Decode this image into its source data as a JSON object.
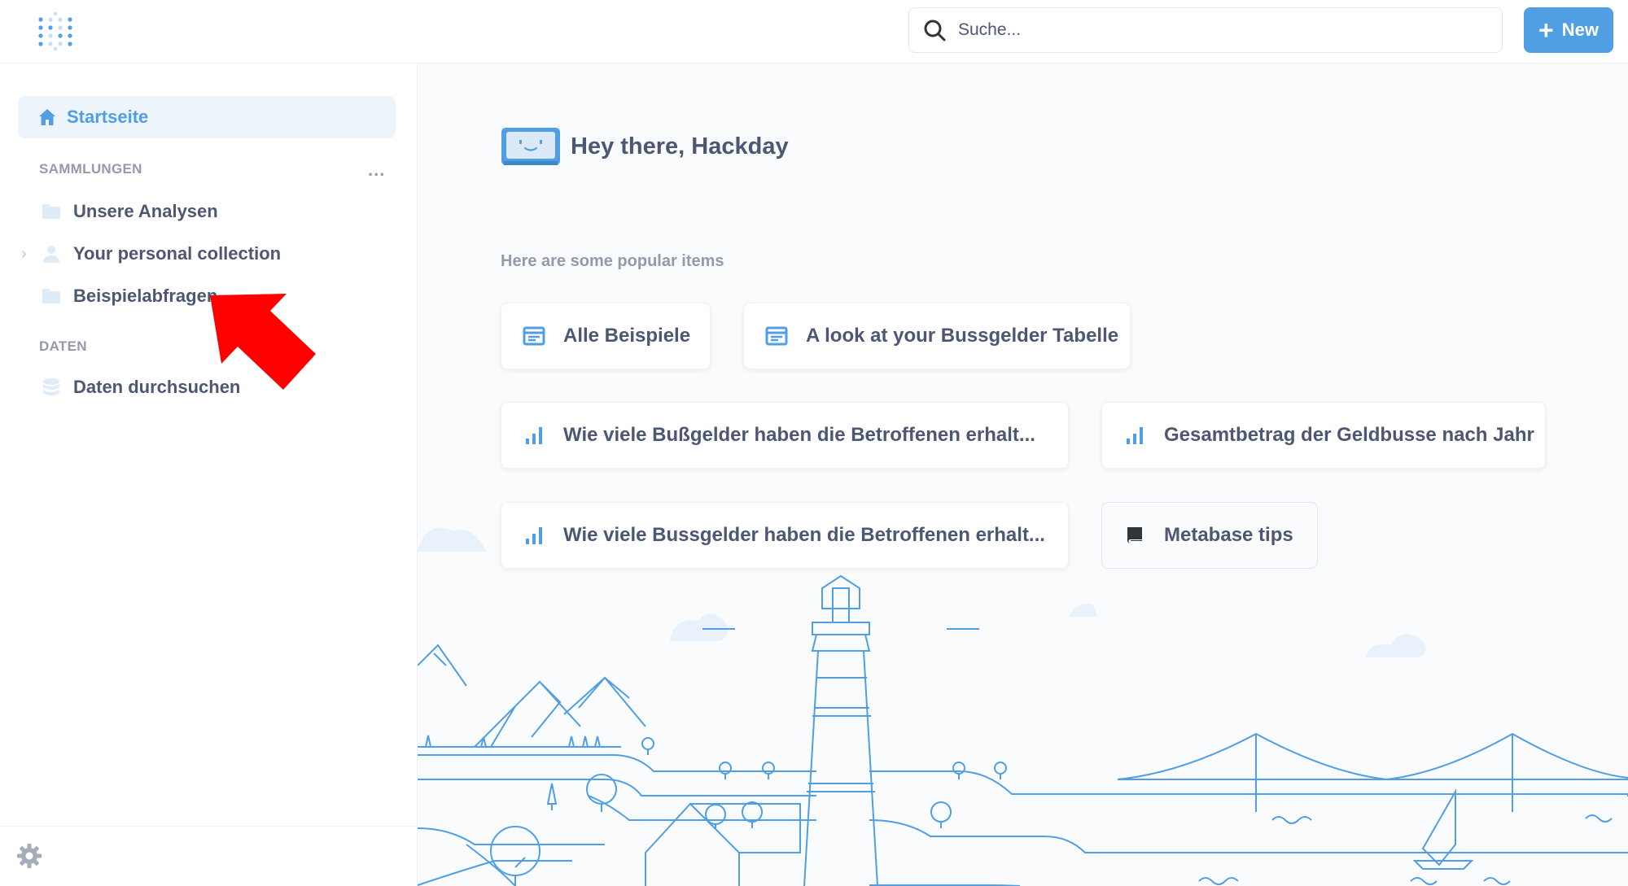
{
  "header": {
    "search_placeholder": "Suche...",
    "new_label": "New",
    "accent_color": "#509ee3"
  },
  "sidebar": {
    "home_label": "Startseite",
    "collections_title": "SAMMLUNGEN",
    "collections_more": "...",
    "collections": [
      {
        "label": "Unsere Analysen",
        "icon": "folder-icon"
      },
      {
        "label": "Your personal collection",
        "icon": "person-icon",
        "expandable": true
      },
      {
        "label": "Beispielabfragen",
        "icon": "folder-icon"
      }
    ],
    "data_title": "DATEN",
    "data_items": [
      {
        "label": "Daten durchsuchen",
        "icon": "database-icon"
      }
    ]
  },
  "main": {
    "greeting": "Hey there, Hackday",
    "popular_title": "Here are some popular items",
    "items": [
      {
        "label": "Alle Beispiele",
        "icon": "table-icon"
      },
      {
        "label": "A look at your Bussgelder Tabelle",
        "icon": "table-icon"
      },
      {
        "label": "Wie viele Bußgelder haben die Betroffenen erhalt...",
        "icon": "bar-chart-icon"
      },
      {
        "label": "Gesamtbetrag der Geldbusse nach Jahr",
        "icon": "bar-chart-icon"
      },
      {
        "label": "Wie viele Bussgelder haben die Betroffenen erhalt...",
        "icon": "bar-chart-icon"
      },
      {
        "label": "Metabase tips",
        "icon": "book-icon"
      }
    ]
  }
}
